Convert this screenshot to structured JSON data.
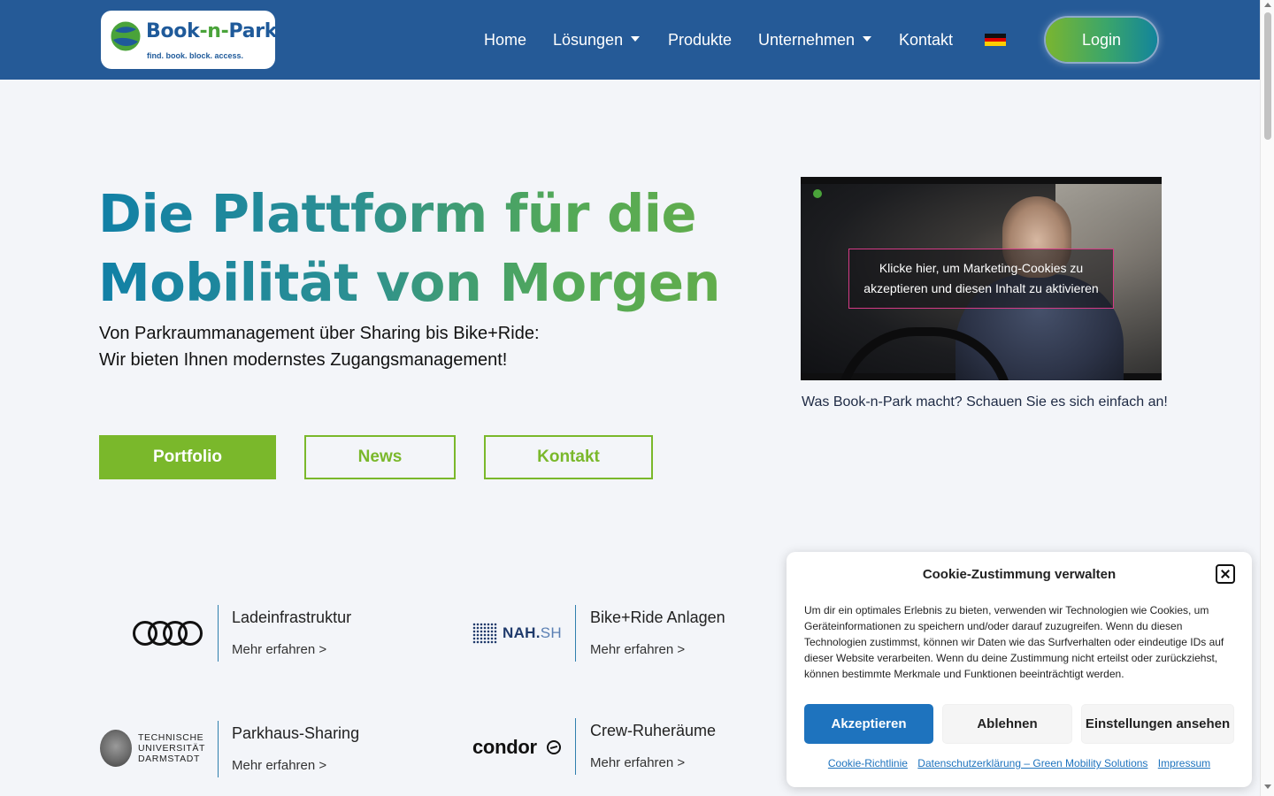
{
  "header": {
    "logo": {
      "name_a": "Book",
      "name_dash": "-n-",
      "name_b": "Park",
      "tagline": "find. book. block. access."
    },
    "nav": {
      "home": "Home",
      "loesungen": "Lösungen",
      "produkte": "Produkte",
      "unternehmen": "Unternehmen",
      "kontakt": "Kontakt"
    },
    "language_flag": "de-flag-icon",
    "login_label": "Login"
  },
  "hero": {
    "title_line1": "Die Plattform für die",
    "title_line2": "Mobilität von Morgen",
    "subtitle_line1": "Von Parkraummanagement über Sharing bis Bike+Ride:",
    "subtitle_line2": "Wir bieten Ihnen modernstes Zugangsmanagement!",
    "buttons": {
      "portfolio": "Portfolio",
      "news": "News",
      "kontakt": "Kontakt"
    }
  },
  "video": {
    "cookie_notice": "Klicke hier, um Marketing-Cookies zu akzeptieren und diesen Inhalt zu aktivieren",
    "caption": "Was Book-n-Park macht? Schauen Sie es sich einfach an!"
  },
  "partners": [
    {
      "logo": "audi-logo",
      "title": "Ladeinfrastruktur",
      "more": "Mehr erfahren >"
    },
    {
      "logo": "nah-sh-logo",
      "logo_text_a": "NAH.",
      "logo_text_b": "SH",
      "title": "Bike+Ride Anlagen",
      "more": "Mehr erfahren >"
    },
    {
      "logo": "tu-darmstadt-logo",
      "logo_text_1": "TECHNISCHE",
      "logo_text_2": "UNIVERSITÄT",
      "logo_text_3": "DARMSTADT",
      "title": "Parkhaus-Sharing",
      "more": "Mehr erfahren >"
    },
    {
      "logo": "condor-logo",
      "logo_text": "condor",
      "title": "Crew-Ruheräume",
      "more": "Mehr erfahren >"
    }
  ],
  "consent": {
    "title": "Cookie-Zustimmung verwalten",
    "text": "Um dir ein optimales Erlebnis zu bieten, verwenden wir Technologien wie Cookies, um Geräteinformationen zu speichern und/oder darauf zuzugreifen. Wenn du diesen Technologien zustimmst, können wir Daten wie das Surfverhalten oder eindeutige IDs auf dieser Website verarbeiten. Wenn du deine Zustimmung nicht erteilst oder zurückziehst, können bestimmte Merkmale und Funktionen beeinträchtigt werden.",
    "accept": "Akzeptieren",
    "deny": "Ablehnen",
    "preferences": "Einstellungen ansehen",
    "links": {
      "cookie_policy": "Cookie-Richtlinie",
      "privacy": "Datenschutzerklärung – Green Mobility Solutions",
      "imprint": "Impressum"
    }
  },
  "colors": {
    "header_bg": "#255a97",
    "page_bg": "#f3f5f9",
    "accent_green": "#7ab82b",
    "consent_blue": "#1e73be"
  }
}
